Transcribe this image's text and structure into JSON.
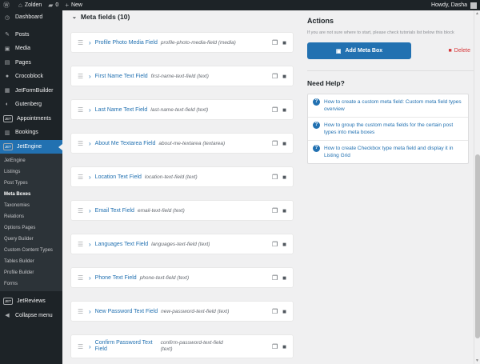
{
  "admin_bar": {
    "wp_icon": "wordpress-icon",
    "site_name": "Zolden",
    "comments_count": "0",
    "new_label": "New",
    "greeting": "Howdy, Dasha"
  },
  "sidebar": {
    "items": [
      {
        "label": "Dashboard",
        "icon": "dashboard-icon"
      },
      {
        "label": "Posts",
        "icon": "pin-icon"
      },
      {
        "label": "Media",
        "icon": "media-icon"
      },
      {
        "label": "Pages",
        "icon": "pages-icon"
      },
      {
        "label": "Crocoblock",
        "icon": "crocoblock-icon"
      },
      {
        "label": "JetFormBuilder",
        "icon": "jfb-icon"
      },
      {
        "label": "Gutenberg",
        "icon": "gutenberg-icon"
      },
      {
        "label": "Appointments",
        "icon": "appointments-icon",
        "logo": "JET"
      },
      {
        "label": "Bookings",
        "icon": "bookings-icon"
      },
      {
        "label": "JetEngine",
        "icon": "jetengine-icon",
        "logo": "JET",
        "active": true
      }
    ],
    "submenu": [
      "JetEngine",
      "Listings",
      "Post Types",
      "Meta Boxes",
      "Taxonomies",
      "Relations",
      "Options Pages",
      "Query Builder",
      "Custom Content Types",
      "Tables Builder",
      "Profile Builder",
      "Forms"
    ],
    "submenu_current": "Meta Boxes",
    "bottom_items": [
      {
        "label": "JetReviews",
        "icon": "jetreviews-icon",
        "logo": "JET"
      },
      {
        "label": "Collapse menu",
        "icon": "collapse-icon"
      }
    ]
  },
  "meta_fields": {
    "title": "Meta fields (10)",
    "fields": [
      {
        "name": "Profile Photo Media Field",
        "meta": "profile-photo-media-field (media)"
      },
      {
        "name": "First Name Text Field",
        "meta": "first-name-text-field (text)"
      },
      {
        "name": "Last Name Text Field",
        "meta": "last-name-text-field (text)"
      },
      {
        "name": "About Me Textarea Field",
        "meta": "about-me-textarea (textarea)"
      },
      {
        "name": "Location Text Field",
        "meta": "location-text-field (text)"
      },
      {
        "name": "Email Text Field",
        "meta": "email-text-field (text)"
      },
      {
        "name": "Languages Text Field",
        "meta": "languages-text-field (text)"
      },
      {
        "name": "Phone Text Field",
        "meta": "phone-text-field (text)"
      },
      {
        "name": "New Password Text Field",
        "meta": "new-password-text-field (text)"
      },
      {
        "name": "Confirm Password Text Field",
        "meta": "confirm-password-text-field (text)"
      }
    ]
  },
  "actions": {
    "title": "Actions",
    "hint": "If you are not sure where to start, please check tutorials list below this block",
    "add_button": "Add Meta Box",
    "delete_label": "Delete"
  },
  "help": {
    "title": "Need Help?",
    "links": [
      "How to create a custom meta field: Custom meta field types overview",
      "How to group the custom meta fields for the certain post types into meta boxes",
      "How to create Checkbox type meta field and display it in Listing Grid"
    ]
  },
  "colors": {
    "accent": "#2271b1",
    "admin_dark": "#1d2327",
    "danger": "#d63638"
  }
}
